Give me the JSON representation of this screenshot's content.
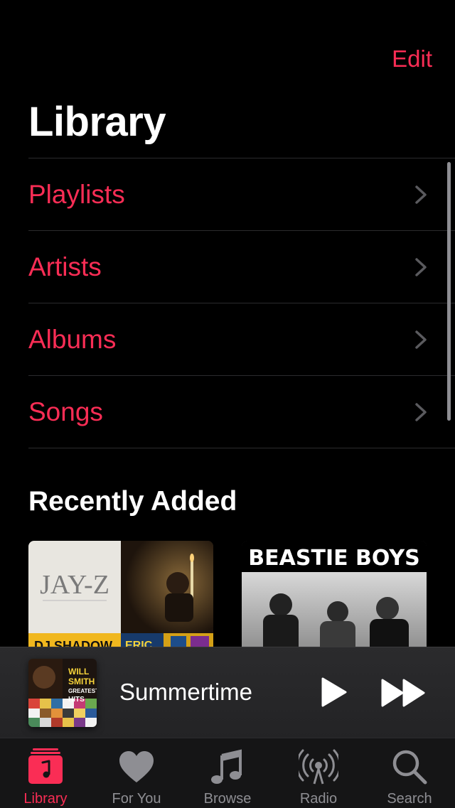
{
  "header": {
    "edit_label": "Edit",
    "title": "Library"
  },
  "menu": [
    {
      "label": "Playlists"
    },
    {
      "label": "Artists"
    },
    {
      "label": "Albums"
    },
    {
      "label": "Songs"
    }
  ],
  "recently_added": {
    "title": "Recently Added",
    "albums": [
      {
        "cover_texts": [
          "JAY-Z",
          "DJ SHADOW",
          "ERIC"
        ]
      },
      {
        "cover_texts": [
          "BEASTIE BOYS"
        ]
      }
    ]
  },
  "mini_player": {
    "song_title": "Summertime",
    "art_texts": [
      "WILL",
      "SMITH",
      "GREATEST",
      "HITS"
    ]
  },
  "tabs": [
    {
      "label": "Library",
      "icon": "library-icon",
      "active": true
    },
    {
      "label": "For You",
      "icon": "heart-icon",
      "active": false
    },
    {
      "label": "Browse",
      "icon": "music-note-icon",
      "active": false
    },
    {
      "label": "Radio",
      "icon": "radio-icon",
      "active": false
    },
    {
      "label": "Search",
      "icon": "search-icon",
      "active": false
    }
  ],
  "colors": {
    "accent": "#fa2d55",
    "inactive": "#8e8e93",
    "background": "#000000"
  }
}
